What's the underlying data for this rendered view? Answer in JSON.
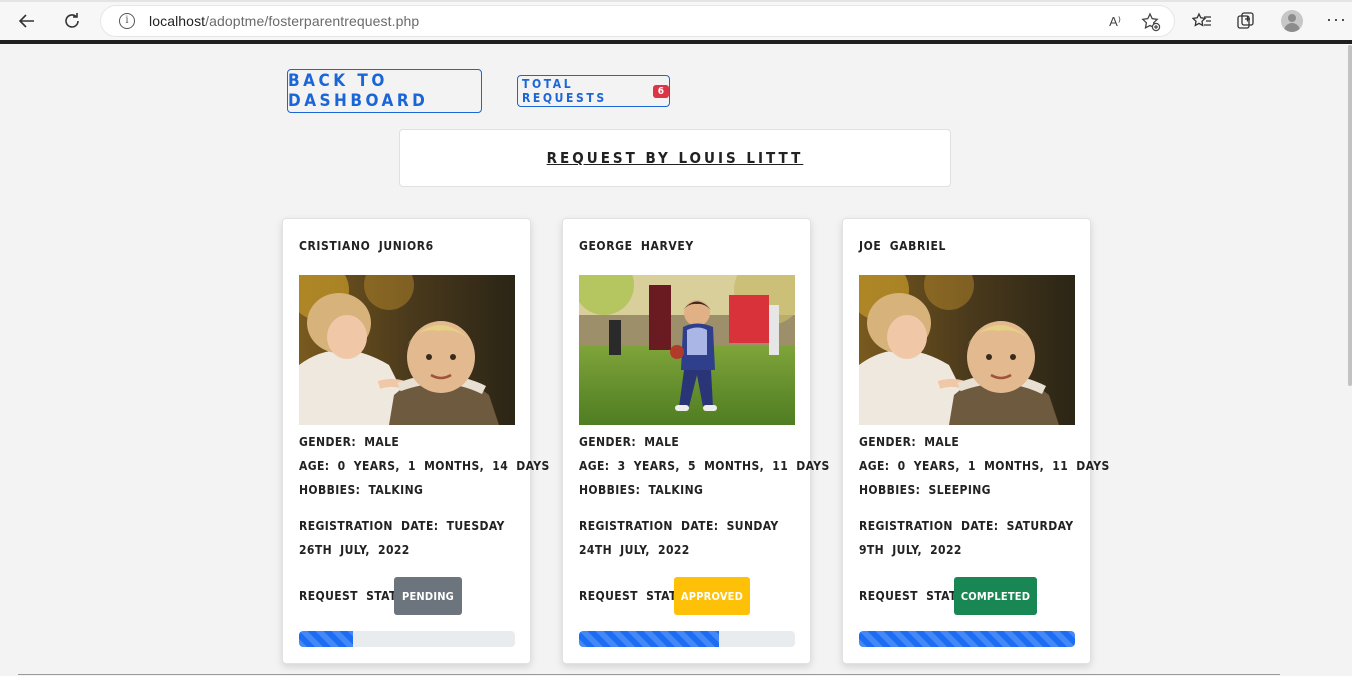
{
  "browser": {
    "url_host": "localhost",
    "url_path": "/adoptme/fosterparentrequest.php",
    "info_glyph": "i",
    "read_aloud_glyph": "A⁾"
  },
  "header": {
    "back_button": "Back to Dashboard",
    "total_requests_label": "Total Requests",
    "total_requests_count": "6",
    "title": "Request by Louis Littt"
  },
  "labels": {
    "gender": "Gender:",
    "age": "Age:",
    "hobbies": "Hobbies:",
    "registration_date": "Registration Date:",
    "request_status": "Request Status:"
  },
  "requests": [
    {
      "name": "Cristiano Junior6",
      "gender": "Male",
      "age": "0 years, 1 months, 14 days",
      "hobbies": "Talking",
      "registration_date": "Tuesday 26th July, 2022",
      "status": "Pending",
      "status_color": "#6c757d",
      "status_text_color": "#ffffff",
      "progress": 0.25,
      "photo": "toddlers-girl-boy"
    },
    {
      "name": "George Harvey",
      "gender": "Male",
      "age": "3 years, 5 months, 11 days",
      "hobbies": "Talking",
      "registration_date": "Sunday 24th July, 2022",
      "status": "Approved",
      "status_color": "#ffc107",
      "status_text_color": "#ffffff",
      "progress": 0.65,
      "photo": "toddler-football-field"
    },
    {
      "name": "Joe Gabriel",
      "gender": "Male",
      "age": "0 years, 1 months, 11 days",
      "hobbies": "Sleeping",
      "registration_date": "Saturday 9th July, 2022",
      "status": "Completed",
      "status_color": "#198754",
      "status_text_color": "#ffffff",
      "progress": 1.0,
      "photo": "toddlers-girl-boy"
    }
  ]
}
